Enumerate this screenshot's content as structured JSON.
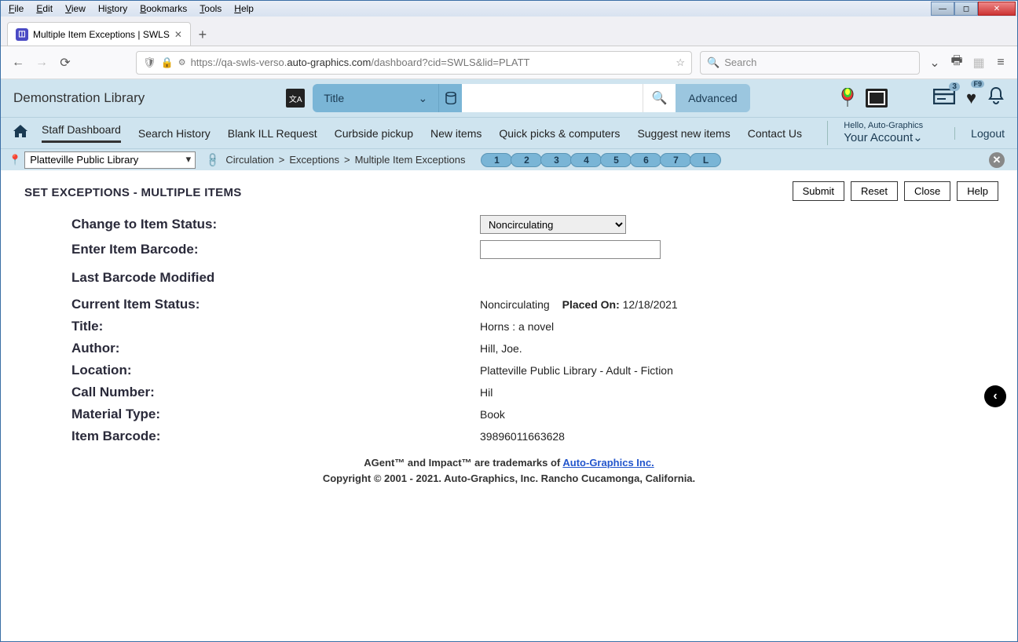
{
  "os_menu": [
    "File",
    "Edit",
    "View",
    "History",
    "Bookmarks",
    "Tools",
    "Help"
  ],
  "tab_title": "Multiple Item Exceptions | SWLS",
  "url": {
    "prefix": "https://qa-swls-verso.",
    "bold": "auto-graphics.com",
    "suffix": "/dashboard?cid=SWLS&lid=PLATT"
  },
  "browser_search_placeholder": "Search",
  "library_name": "Demonstration Library",
  "search_scope": "Title",
  "advanced": "Advanced",
  "card_badge": "3",
  "heart_key": "F9",
  "nav": [
    "Staff Dashboard",
    "Search History",
    "Blank ILL Request",
    "Curbside pickup",
    "New items",
    "Quick picks & computers",
    "Suggest new items",
    "Contact Us"
  ],
  "hello": "Hello, Auto-Graphics",
  "your_account": "Your Account",
  "logout": "Logout",
  "library_select": "Platteville Public Library",
  "breadcrumb": [
    "Circulation",
    "Exceptions",
    "Multiple Item Exceptions"
  ],
  "pills": [
    "1",
    "2",
    "3",
    "4",
    "5",
    "6",
    "7",
    "L"
  ],
  "buttons": {
    "submit": "Submit",
    "reset": "Reset",
    "close": "Close",
    "help": "Help"
  },
  "page_heading": "SET EXCEPTIONS - MULTIPLE ITEMS",
  "labels": {
    "change_status": "Change to Item Status:",
    "enter_barcode": "Enter Item Barcode:",
    "last_modified": "Last Barcode Modified",
    "current_status": "Current Item Status:",
    "title": "Title:",
    "author": "Author:",
    "location": "Location:",
    "call_number": "Call Number:",
    "material": "Material Type:",
    "barcode": "Item Barcode:",
    "placed_on": "Placed On:"
  },
  "status_option": "Noncirculating",
  "item": {
    "status": "Noncirculating",
    "placed_on": "12/18/2021",
    "title": "Horns : a novel",
    "author": "Hill, Joe.",
    "location": "Platteville Public Library - Adult - Fiction",
    "call_number": " Hil",
    "material": "Book",
    "barcode": "39896011663628"
  },
  "footer": {
    "line1_a": "AGent™ and Impact™ are trademarks of ",
    "line1_link": "Auto-Graphics Inc.",
    "line2": "Copyright © 2001 - 2021. Auto-Graphics, Inc. Rancho Cucamonga, California."
  }
}
